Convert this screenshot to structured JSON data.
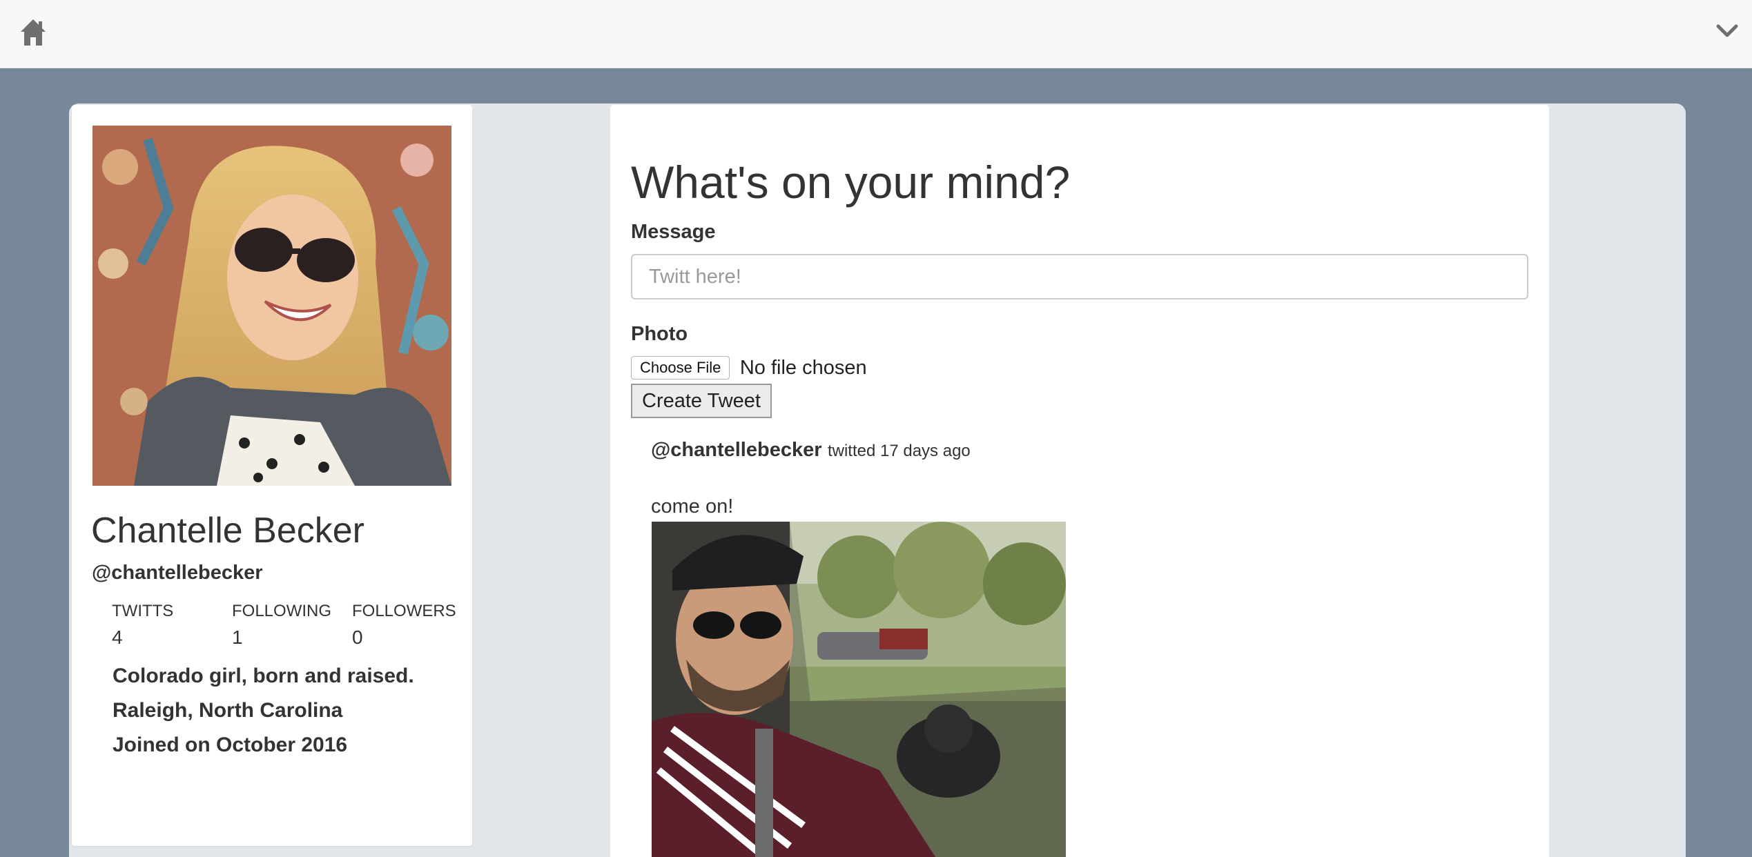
{
  "navbar": {
    "home_icon": "home-icon",
    "menu_icon": "chevron-down-icon"
  },
  "profile": {
    "name": "Chantelle Becker",
    "handle": "@chantellebecker",
    "stats": [
      {
        "label": "TWITTS",
        "value": "4"
      },
      {
        "label": "FOLLOWING",
        "value": "1"
      },
      {
        "label": "FOLLOWERS",
        "value": "0"
      }
    ],
    "bio": "Colorado girl, born and raised.",
    "location": "Raleigh, North Carolina",
    "joined": "Joined on October 2016"
  },
  "compose": {
    "title": "What's on your mind?",
    "message_label": "Message",
    "message_placeholder": "Twitt here!",
    "photo_label": "Photo",
    "choose_file_label": "Choose File",
    "file_status": "No file chosen",
    "submit_label": "Create Tweet"
  },
  "tweets": [
    {
      "author": "@chantellebecker",
      "meta": "twitted 17 days ago",
      "text": "come on!"
    }
  ],
  "colors": {
    "page_background": "#778899",
    "navbar_background": "#f8f8f8",
    "container_background": "#e2e5ea",
    "card_background": "#ffffff",
    "text": "#333333"
  }
}
